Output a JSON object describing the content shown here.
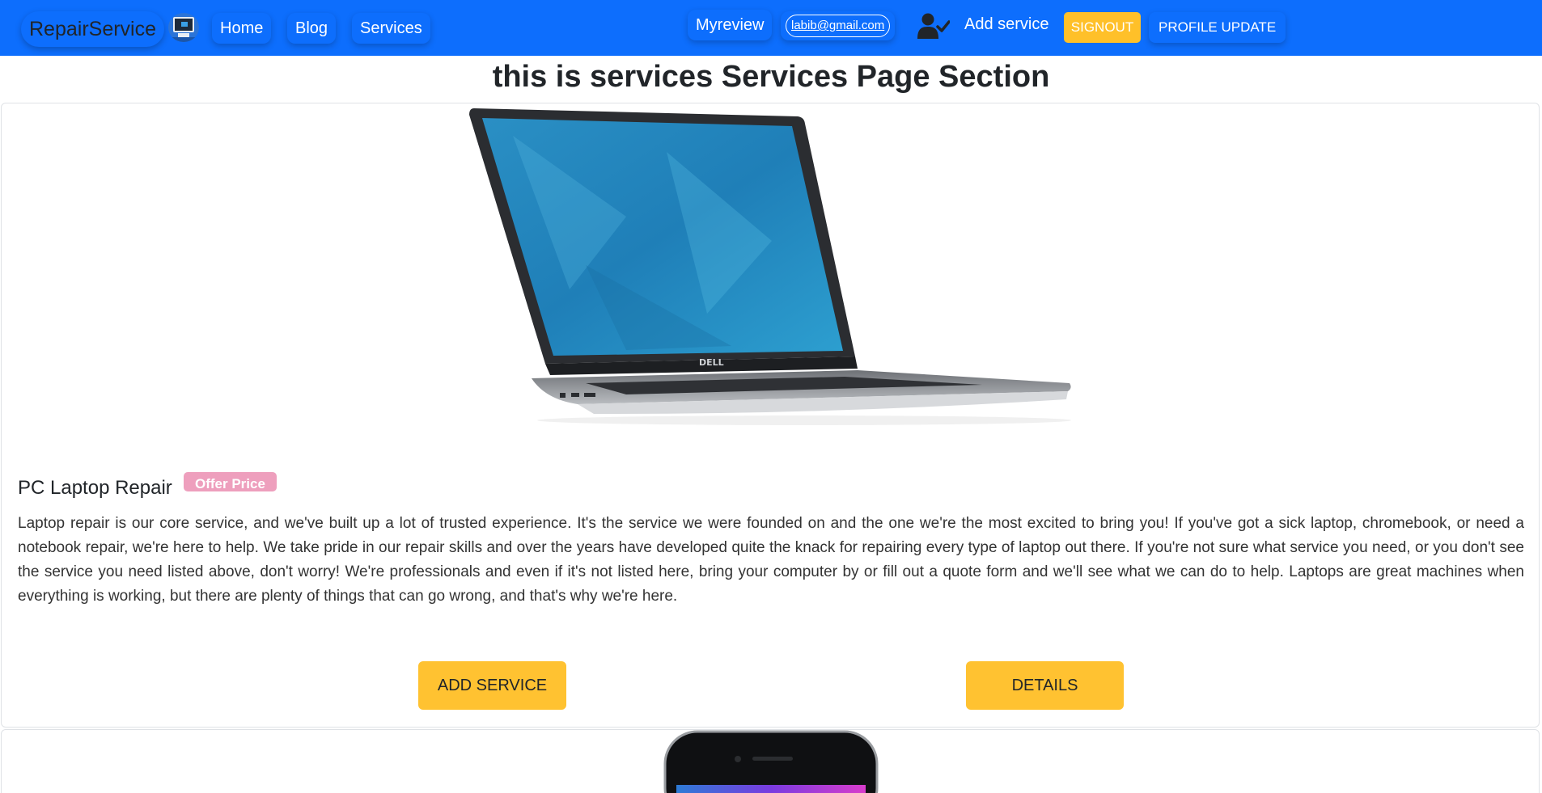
{
  "nav": {
    "brand": "RepairService",
    "links": [
      "Home",
      "Blog",
      "Services"
    ],
    "myreview": "Myreview",
    "email": "labib@gmail.com",
    "add_service": "Add service",
    "signout": "SIGNOUT",
    "profile_update": "PROFILE UPDATE",
    "icons": [
      "site-logo-icon",
      "user-check-icon"
    ],
    "colors": {
      "navbar": "#0d6efd",
      "signout": "#ffc029"
    }
  },
  "page": {
    "title": "this is services Services Page Section"
  },
  "services": [
    {
      "name": "PC Laptop Repair",
      "badge": "Offer Price",
      "description": "Laptop repair is our core service, and we've built up a lot of trusted experience. It's the service we were founded on and the one we're the most excited to bring you! If you've got a sick laptop, chromebook, or need a notebook repair, we're here to help. We take pride in our repair skills and over the years have developed quite the knack for repairing every type of laptop out there. If you're not sure what service you need, or you don't see the service you need listed above, don't worry! We're professionals and even if it's not listed here, bring your computer by or fill out a quote form and we'll see what we can do to help. Laptops are great machines when everything is working, but there are plenty of things that can go wrong, and that's why we're here.",
      "add_label": "ADD SERVICE",
      "details_label": "DETAILS",
      "colors": {
        "badge": "#ee9fbd",
        "button": "#ffc231"
      }
    }
  ]
}
